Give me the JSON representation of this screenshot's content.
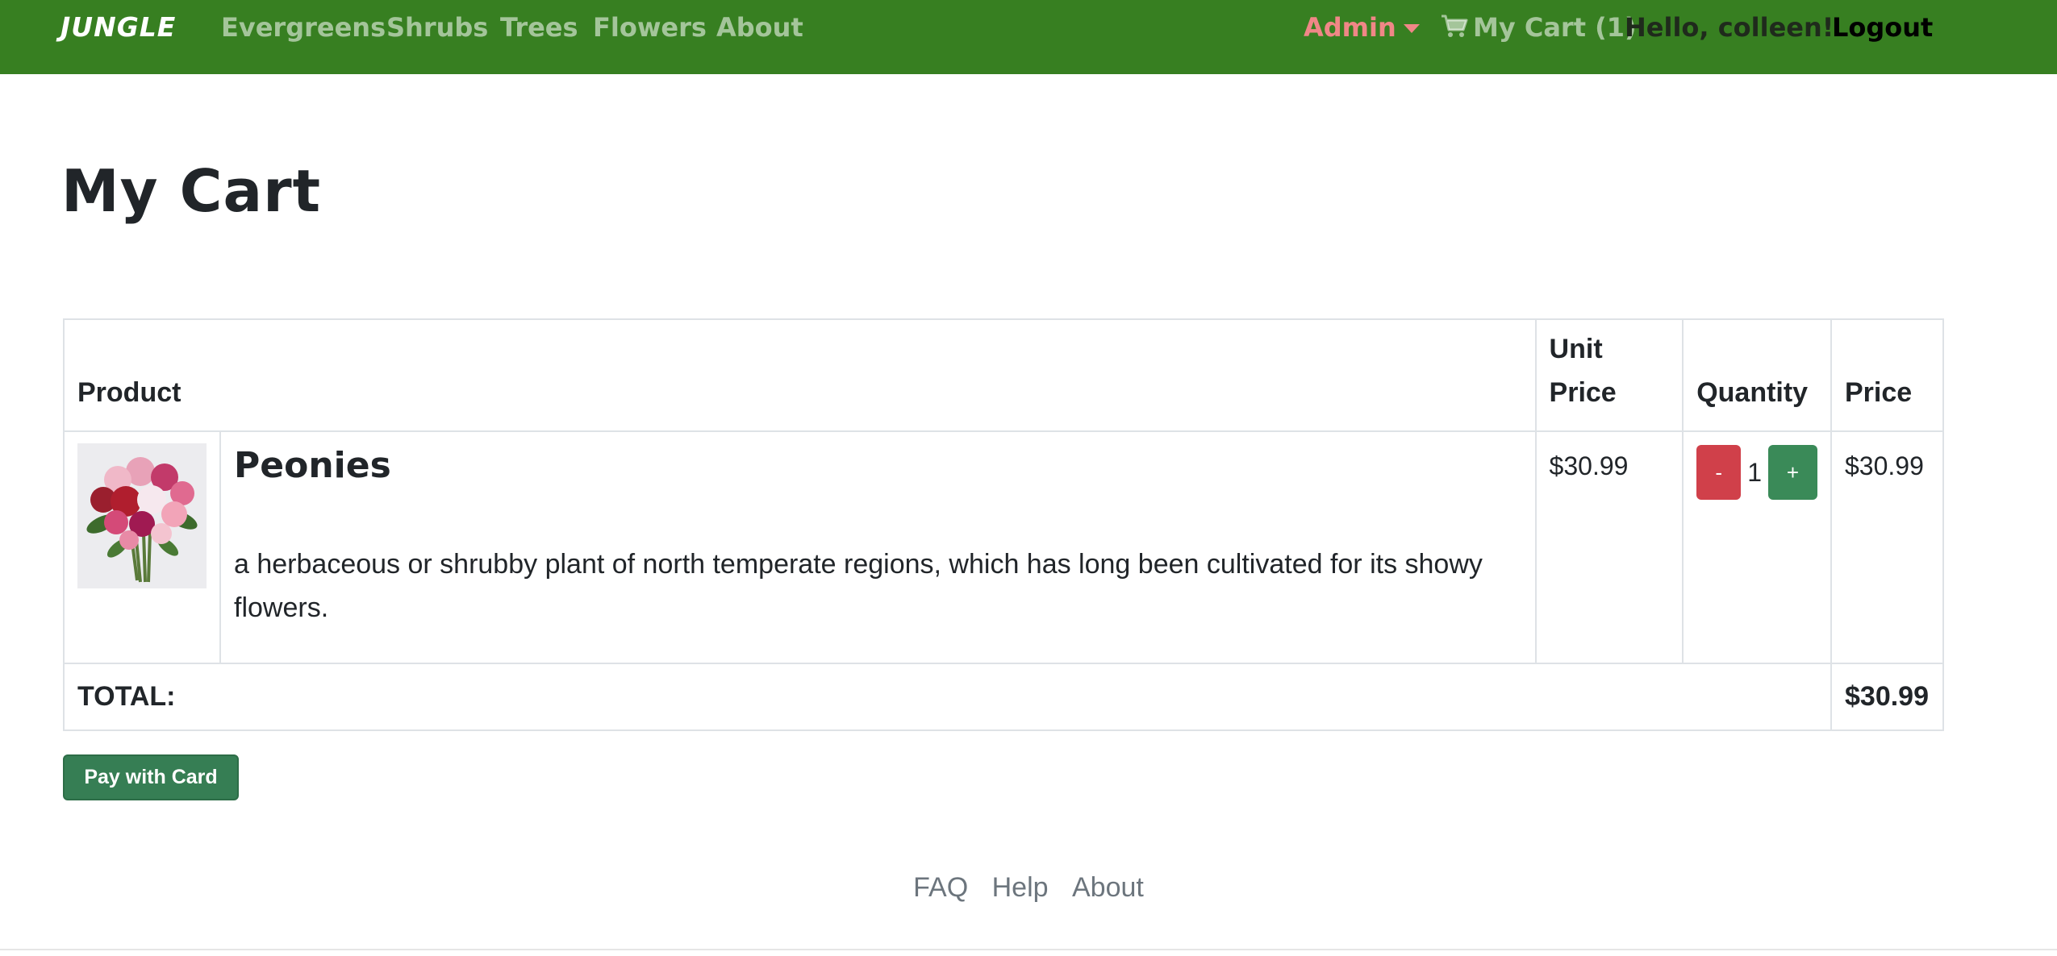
{
  "navbar": {
    "brand": "JUNGLE",
    "links": [
      "Evergreens",
      "Shrubs",
      "Trees",
      "Flowers",
      "About"
    ],
    "admin_label": "Admin",
    "cart_label": "My Cart (1)",
    "greeting": "Hello, colleen!",
    "logout_label": "Logout"
  },
  "page": {
    "title": "My Cart"
  },
  "table": {
    "headers": {
      "product": "Product",
      "unit_price_line1": "Unit",
      "unit_price_line2": "Price",
      "quantity": "Quantity",
      "price": "Price"
    },
    "items": [
      {
        "image_icon": "peonies-bouquet-image",
        "name": "Peonies",
        "description": "a herbaceous or shrubby plant of north temperate regions, which has long been cultivated for its showy flowers.",
        "unit_price": "$30.99",
        "quantity": "1",
        "decrement_label": "-",
        "increment_label": "+",
        "price": "$30.99"
      }
    ],
    "total_label": "TOTAL:",
    "total_value": "$30.99"
  },
  "actions": {
    "pay_label": "Pay with Card"
  },
  "footer": {
    "links": [
      "FAQ",
      "Help",
      "About"
    ]
  },
  "colors": {
    "navbar_bg": "#377f21",
    "admin": "#f08787",
    "minus_button": "#d0404a",
    "plus_button": "#3a8a58",
    "pay_button": "#367e54"
  }
}
